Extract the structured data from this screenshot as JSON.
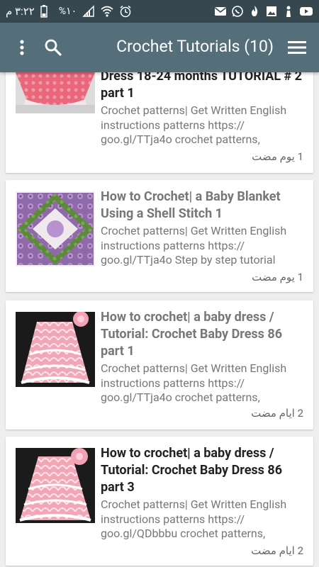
{
  "status_bar": {
    "time": "٣:٢٢ م",
    "battery_pct": "%١٠",
    "left_icons": [
      "mail-icon",
      "whatsapp-icon",
      "flame-icon",
      "image-icon",
      "figure-icon",
      "youtube-icon"
    ],
    "right_icons": [
      "battery-icon",
      "signal-icon",
      "wifi-icon",
      "alarm-icon"
    ]
  },
  "app_bar": {
    "title": "Crochet Tutorials (10)"
  },
  "list": [
    {
      "title": "Dress 18-24 months TUTORIAL # 2 part 1",
      "desc": "Crochet patterns| Get Written English instructions patterns https:// goo.gl/TTja4o crochet patterns,",
      "date": "1 يوم مضت",
      "visited": false
    },
    {
      "title": "How to Crochet| a Baby Blanket Using a Shell Stitch 1",
      "desc": "Crochet patterns| Get Written English instructions patterns https:// goo.gl/TTja4o Step by step tutorial",
      "date": "1 يوم مضت",
      "visited": true
    },
    {
      "title": "How to crochet| a baby dress / Tutorial: Crochet Baby Dress 86 part 1",
      "desc": "Crochet patterns| Get Written English instructions patterns https:// goo.gl/TTja4o crochet patterns,",
      "date": "2 ايام مضت",
      "visited": true
    },
    {
      "title": "How to crochet| a baby dress / Tutorial: Crochet Baby Dress 86 part 3",
      "desc": "Crochet patterns| Get Written English instructions patterns https:// goo.gl/QDbbbu crochet patterns,",
      "date": "2 ايام مضت",
      "visited": false
    }
  ],
  "colors": {
    "status_bar": "#37474f",
    "app_bar": "#546e7a",
    "background": "#eeeeee"
  }
}
